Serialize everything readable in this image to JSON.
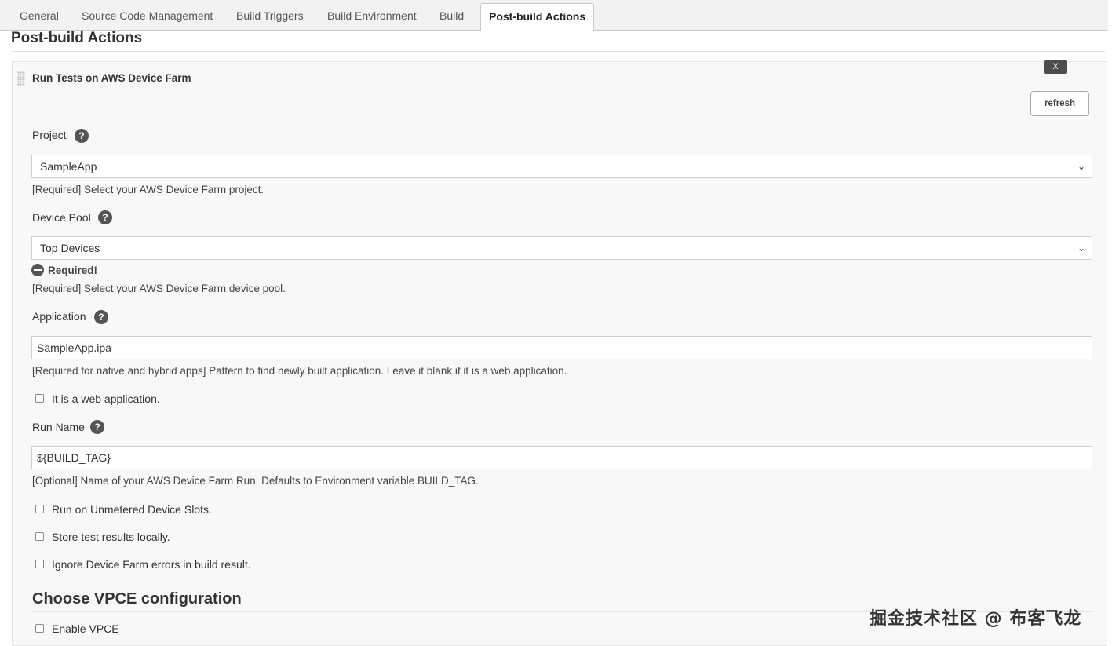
{
  "tabs": [
    {
      "label": "General"
    },
    {
      "label": "Source Code Management"
    },
    {
      "label": "Build Triggers"
    },
    {
      "label": "Build Environment"
    },
    {
      "label": "Build"
    },
    {
      "label": "Post-build Actions"
    }
  ],
  "section_title": "Post-build Actions",
  "step": {
    "title": "Run Tests on AWS Device Farm",
    "close_label": "X",
    "refresh_label": "refresh"
  },
  "help_glyph": "?",
  "project": {
    "label": "Project",
    "value": "SampleApp",
    "desc": "[Required] Select your AWS Device Farm project."
  },
  "device_pool": {
    "label": "Device Pool",
    "value": "Top Devices",
    "error": "Required!",
    "desc": "[Required] Select your AWS Device Farm device pool."
  },
  "application": {
    "label": "Application",
    "value": "SampleApp.ipa",
    "desc": "[Required for native and hybrid apps] Pattern to find newly built application. Leave it blank if it is a web application."
  },
  "web_app_checkbox": {
    "label": "It is a web application.",
    "checked": false
  },
  "run_name": {
    "label": "Run Name",
    "value": "${BUILD_TAG}",
    "desc": "[Optional] Name of your AWS Device Farm Run. Defaults to Environment variable BUILD_TAG."
  },
  "options": [
    {
      "label": "Run on Unmetered Device Slots.",
      "checked": false
    },
    {
      "label": "Store test results locally.",
      "checked": false
    },
    {
      "label": "Ignore Device Farm errors in build result.",
      "checked": false
    }
  ],
  "vpce": {
    "heading": "Choose VPCE configuration",
    "enable_label": "Enable VPCE",
    "checked": false
  },
  "watermark": "掘金技术社区 @ 布客飞龙",
  "icons": {
    "select_chevron": "chevron-down-icon",
    "error": "minus-circle-icon",
    "help": "question-circle-icon"
  }
}
